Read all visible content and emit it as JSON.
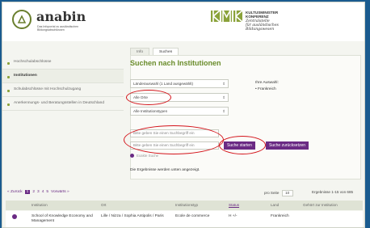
{
  "header": {
    "logo_name": "anabin",
    "logo_tagline": "Das Infoportal zu ausländischen Bildungsabschlüssen",
    "kmk_title": [
      "KULTUSMINISTER",
      "KONFERENZ"
    ],
    "kmk_subtitle": [
      "Zentralstelle",
      "für ausländisches",
      "Bildungswesen"
    ]
  },
  "sidebar": {
    "items": [
      {
        "label": "Hochschulabschlüsse",
        "active": false
      },
      {
        "label": "Institutionen",
        "active": true
      },
      {
        "label": "Schulabschlüsse mit Hochschulzugang",
        "active": false
      },
      {
        "label": "Anerkennungs- und Beratungsstellen in Deutschland",
        "active": false
      }
    ]
  },
  "tabs": [
    {
      "label": "Info",
      "active": false
    },
    {
      "label": "Suchen",
      "active": true
    }
  ],
  "search": {
    "title": "Suchen nach Institutionen",
    "country_select": "Länderauswahl (1 Land ausgewählt)",
    "place_select": "Alle Orte",
    "type_select": "Alle Institutionstypen",
    "term_placeholder_1": "Bitte geben Sie einen Suchbegriff ein",
    "term_placeholder_2": "Bitte geben Sie einen Suchbegriff ein",
    "search_button": "Suche starten",
    "reset_button": "Suche zurücksetzen",
    "radio_label": "Exakte Suche",
    "note": "Die Ergebnisse werden unten angezeigt."
  },
  "selection": {
    "label": "Ihre Auswahl:",
    "items": [
      "Frankreich"
    ]
  },
  "pager": {
    "back": "« Zurück",
    "pages": [
      "1",
      "2",
      "3",
      "4",
      "5"
    ],
    "current": "1",
    "forward": "Vorwärts »",
    "per_page_label": "pro Seite",
    "per_page_value": "10",
    "results": "Ergebnisse 1-15 von 685"
  },
  "table": {
    "headers": [
      "Institution",
      "Ort",
      "Institutionstyp",
      "Status",
      "Land",
      "Gehört zur Institution"
    ],
    "rows": [
      {
        "institution": "School of Knowledge Economy and Management",
        "ort": "Lille / Nizza / Sophia Antipolis / Paris",
        "typ": "Ecole de commerce",
        "status": "H +/-",
        "land": "Frankreich",
        "gehoert": ""
      }
    ]
  },
  "colors": {
    "brand_green": "#6a8c2b",
    "button_purple": "#6a2a84",
    "annotation_red": "#d4141b"
  }
}
